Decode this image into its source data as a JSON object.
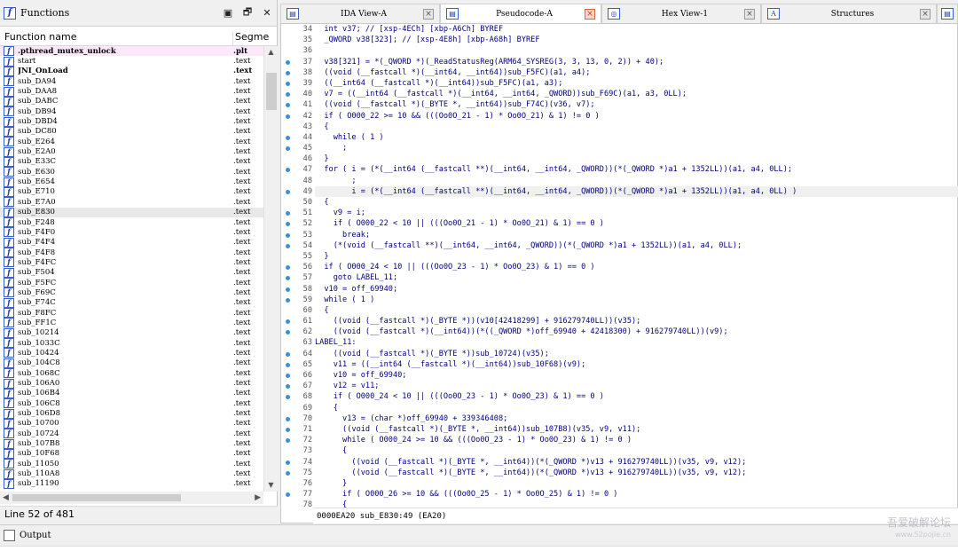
{
  "functions_panel": {
    "title": "Functions",
    "title_buttons": [
      "▣",
      "🗗",
      "✕"
    ],
    "col_name": "Function name",
    "col_segment": "Segme",
    "status": "Line 52 of 481",
    "rows": [
      {
        "name": ".pthread_mutex_unlock",
        "seg": ".plt",
        "style": "imp"
      },
      {
        "name": "start",
        "seg": ".text",
        "style": ""
      },
      {
        "name": "JNI_OnLoad",
        "seg": ".text",
        "style": "bold"
      },
      {
        "name": "sub_DA94",
        "seg": ".text",
        "style": ""
      },
      {
        "name": "sub_DAA8",
        "seg": ".text",
        "style": ""
      },
      {
        "name": "sub_DABC",
        "seg": ".text",
        "style": ""
      },
      {
        "name": "sub_DB94",
        "seg": ".text",
        "style": ""
      },
      {
        "name": "sub_DBD4",
        "seg": ".text",
        "style": ""
      },
      {
        "name": "sub_DC80",
        "seg": ".text",
        "style": ""
      },
      {
        "name": "sub_E264",
        "seg": ".text",
        "style": ""
      },
      {
        "name": "sub_E2A0",
        "seg": ".text",
        "style": ""
      },
      {
        "name": "sub_E33C",
        "seg": ".text",
        "style": ""
      },
      {
        "name": "sub_E630",
        "seg": ".text",
        "style": ""
      },
      {
        "name": "sub_E654",
        "seg": ".text",
        "style": ""
      },
      {
        "name": "sub_E710",
        "seg": ".text",
        "style": ""
      },
      {
        "name": "sub_E7A0",
        "seg": ".text",
        "style": ""
      },
      {
        "name": "sub_E830",
        "seg": ".text",
        "style": "sel"
      },
      {
        "name": "sub_F248",
        "seg": ".text",
        "style": ""
      },
      {
        "name": "sub_F4F0",
        "seg": ".text",
        "style": ""
      },
      {
        "name": "sub_F4F4",
        "seg": ".text",
        "style": ""
      },
      {
        "name": "sub_F4F8",
        "seg": ".text",
        "style": ""
      },
      {
        "name": "sub_F4FC",
        "seg": ".text",
        "style": ""
      },
      {
        "name": "sub_F504",
        "seg": ".text",
        "style": ""
      },
      {
        "name": "sub_F5FC",
        "seg": ".text",
        "style": ""
      },
      {
        "name": "sub_F69C",
        "seg": ".text",
        "style": ""
      },
      {
        "name": "sub_F74C",
        "seg": ".text",
        "style": ""
      },
      {
        "name": "sub_F8FC",
        "seg": ".text",
        "style": ""
      },
      {
        "name": "sub_FF1C",
        "seg": ".text",
        "style": ""
      },
      {
        "name": "sub_10214",
        "seg": ".text",
        "style": ""
      },
      {
        "name": "sub_1033C",
        "seg": ".text",
        "style": ""
      },
      {
        "name": "sub_10424",
        "seg": ".text",
        "style": ""
      },
      {
        "name": "sub_104C8",
        "seg": ".text",
        "style": ""
      },
      {
        "name": "sub_1068C",
        "seg": ".text",
        "style": ""
      },
      {
        "name": "sub_106A0",
        "seg": ".text",
        "style": ""
      },
      {
        "name": "sub_106B4",
        "seg": ".text",
        "style": ""
      },
      {
        "name": "sub_106C8",
        "seg": ".text",
        "style": ""
      },
      {
        "name": "sub_106D8",
        "seg": ".text",
        "style": ""
      },
      {
        "name": "sub_10700",
        "seg": ".text",
        "style": ""
      },
      {
        "name": "sub_10724",
        "seg": ".text",
        "style": ""
      },
      {
        "name": "sub_107B8",
        "seg": ".text",
        "style": ""
      },
      {
        "name": "sub_10F68",
        "seg": ".text",
        "style": ""
      },
      {
        "name": "sub_11050",
        "seg": ".text",
        "style": ""
      },
      {
        "name": "sub_110A8",
        "seg": ".text",
        "style": ""
      },
      {
        "name": "sub_11190",
        "seg": ".text",
        "style": ""
      }
    ]
  },
  "tabs": [
    {
      "label": "IDA View-A",
      "icon": "ida-view-icon",
      "glyph": "▤",
      "active": false
    },
    {
      "label": "Pseudocode-A",
      "icon": "pseudocode-icon",
      "glyph": "▤",
      "active": true
    },
    {
      "label": "Hex View-1",
      "icon": "hex-view-icon",
      "glyph": "◎",
      "active": false
    },
    {
      "label": "Structures",
      "icon": "structures-icon",
      "glyph": "A",
      "active": false
    }
  ],
  "code_status": "0000EA20 sub_E830:49 (EA20)",
  "code_lines": [
    {
      "n": "34",
      "dot": false,
      "text": "  int v37; // [xsp-4ECh] [xbp-A6Ch] BYREF"
    },
    {
      "n": "35",
      "dot": false,
      "text": "  _QWORD v38[323]; // [xsp-4E8h] [xbp-A68h] BYREF"
    },
    {
      "n": "36",
      "dot": false,
      "text": ""
    },
    {
      "n": "37",
      "dot": true,
      "text": "  v38[321] = *(_QWORD *)(_ReadStatusReg(ARM64_SYSREG(3, 3, 13, 0, 2)) + 40);"
    },
    {
      "n": "38",
      "dot": true,
      "text": "  ((void (__fastcall *)(__int64, __int64))sub_F5FC)(a1, a4);"
    },
    {
      "n": "39",
      "dot": true,
      "text": "  ((__int64 (__fastcall *)(__int64))sub_F5FC)(a1, a3);"
    },
    {
      "n": "40",
      "dot": true,
      "text": "  v7 = ((__int64 (__fastcall *)(__int64, __int64, _QWORD))sub_F69C)(a1, a3, 0LL);"
    },
    {
      "n": "41",
      "dot": true,
      "text": "  ((void (__fastcall *)(_BYTE *, __int64))sub_F74C)(v36, v7);"
    },
    {
      "n": "42",
      "dot": true,
      "text": "  if ( O000_22 >= 10 && (((Oo0O_21 - 1) * Oo0O_21) & 1) != 0 )"
    },
    {
      "n": "43",
      "dot": false,
      "text": "  {"
    },
    {
      "n": "44",
      "dot": true,
      "text": "    while ( 1 )"
    },
    {
      "n": "45",
      "dot": true,
      "text": "      ;"
    },
    {
      "n": "46",
      "dot": false,
      "text": "  }"
    },
    {
      "n": "47",
      "dot": true,
      "text": "  for ( i = (*(__int64 (__fastcall **)(__int64, __int64, _QWORD))(*(_QWORD *)a1 + 1352LL))(a1, a4, 0LL);"
    },
    {
      "n": "48",
      "dot": false,
      "text": "        ;"
    },
    {
      "n": "49",
      "dot": true,
      "text": "        i = (*(__int64 (__fastcall **)(__int64, __int64, _QWORD))(*(_QWORD *)a1 + 1352LL))(a1, a4, 0LL) )",
      "hl": true
    },
    {
      "n": "50",
      "dot": false,
      "text": "  {"
    },
    {
      "n": "51",
      "dot": true,
      "text": "    v9 = i;"
    },
    {
      "n": "52",
      "dot": true,
      "text": "    if ( O000_22 < 10 || (((Oo0O_21 - 1) * Oo0O_21) & 1) == 0 )"
    },
    {
      "n": "53",
      "dot": true,
      "text": "      break;"
    },
    {
      "n": "54",
      "dot": true,
      "text": "    (*(void (__fastcall **)(__int64, __int64, _QWORD))(*(_QWORD *)a1 + 1352LL))(a1, a4, 0LL);"
    },
    {
      "n": "55",
      "dot": false,
      "text": "  }"
    },
    {
      "n": "56",
      "dot": true,
      "text": "  if ( O000_24 < 10 || (((Oo0O_23 - 1) * Oo0O_23) & 1) == 0 )"
    },
    {
      "n": "57",
      "dot": true,
      "text": "    goto LABEL_11;"
    },
    {
      "n": "58",
      "dot": true,
      "text": "  v10 = off_69940;"
    },
    {
      "n": "59",
      "dot": true,
      "text": "  while ( 1 )"
    },
    {
      "n": "60",
      "dot": false,
      "text": "  {"
    },
    {
      "n": "61",
      "dot": true,
      "text": "    ((void (__fastcall *)(_BYTE *))(v10[42418299] + 916279740LL))(v35);"
    },
    {
      "n": "62",
      "dot": true,
      "text": "    ((void (__fastcall *)(__int64))(*((_QWORD *)off_69940 + 42418300) + 916279740LL))(v9);"
    },
    {
      "n": "63",
      "dot": false,
      "text": "LABEL_11:"
    },
    {
      "n": "64",
      "dot": true,
      "text": "    ((void (__fastcall *)(_BYTE *))sub_10724)(v35);"
    },
    {
      "n": "65",
      "dot": true,
      "text": "    v11 = ((__int64 (__fastcall *)(__int64))sub_10F68)(v9);"
    },
    {
      "n": "66",
      "dot": true,
      "text": "    v10 = off_69940;"
    },
    {
      "n": "67",
      "dot": true,
      "text": "    v12 = v11;"
    },
    {
      "n": "68",
      "dot": true,
      "text": "    if ( O000_24 < 10 || (((Oo0O_23 - 1) * Oo0O_23) & 1) == 0 )"
    },
    {
      "n": "69",
      "dot": false,
      "text": "    {"
    },
    {
      "n": "70",
      "dot": true,
      "text": "      v13 = (char *)off_69940 + 339346408;"
    },
    {
      "n": "71",
      "dot": true,
      "text": "      ((void (__fastcall *)(_BYTE *, __int64))sub_107B8)(v35, v9, v11);"
    },
    {
      "n": "72",
      "dot": true,
      "text": "      while ( O000_24 >= 10 && (((Oo0O_23 - 1) * Oo0O_23) & 1) != 0 )"
    },
    {
      "n": "73",
      "dot": false,
      "text": "      {"
    },
    {
      "n": "74",
      "dot": true,
      "text": "        ((void (__fastcall *)(_BYTE *, __int64))(*(_QWORD *)v13 + 916279740LL))(v35, v9, v12);"
    },
    {
      "n": "75",
      "dot": true,
      "text": "        ((void (__fastcall *)(_BYTE *, __int64))(*(_QWORD *)v13 + 916279740LL))(v35, v9, v12);"
    },
    {
      "n": "76",
      "dot": false,
      "text": "      }"
    },
    {
      "n": "77",
      "dot": true,
      "text": "      if ( O000_26 >= 10 && (((Oo0O_25 - 1) * Oo0O_25) & 1) != 0 )"
    },
    {
      "n": "78",
      "dot": false,
      "text": "      {"
    }
  ],
  "output": {
    "label": "Output"
  },
  "watermark": {
    "line1": "吾爱破解论坛",
    "line2": "www.52pojie.cn"
  }
}
